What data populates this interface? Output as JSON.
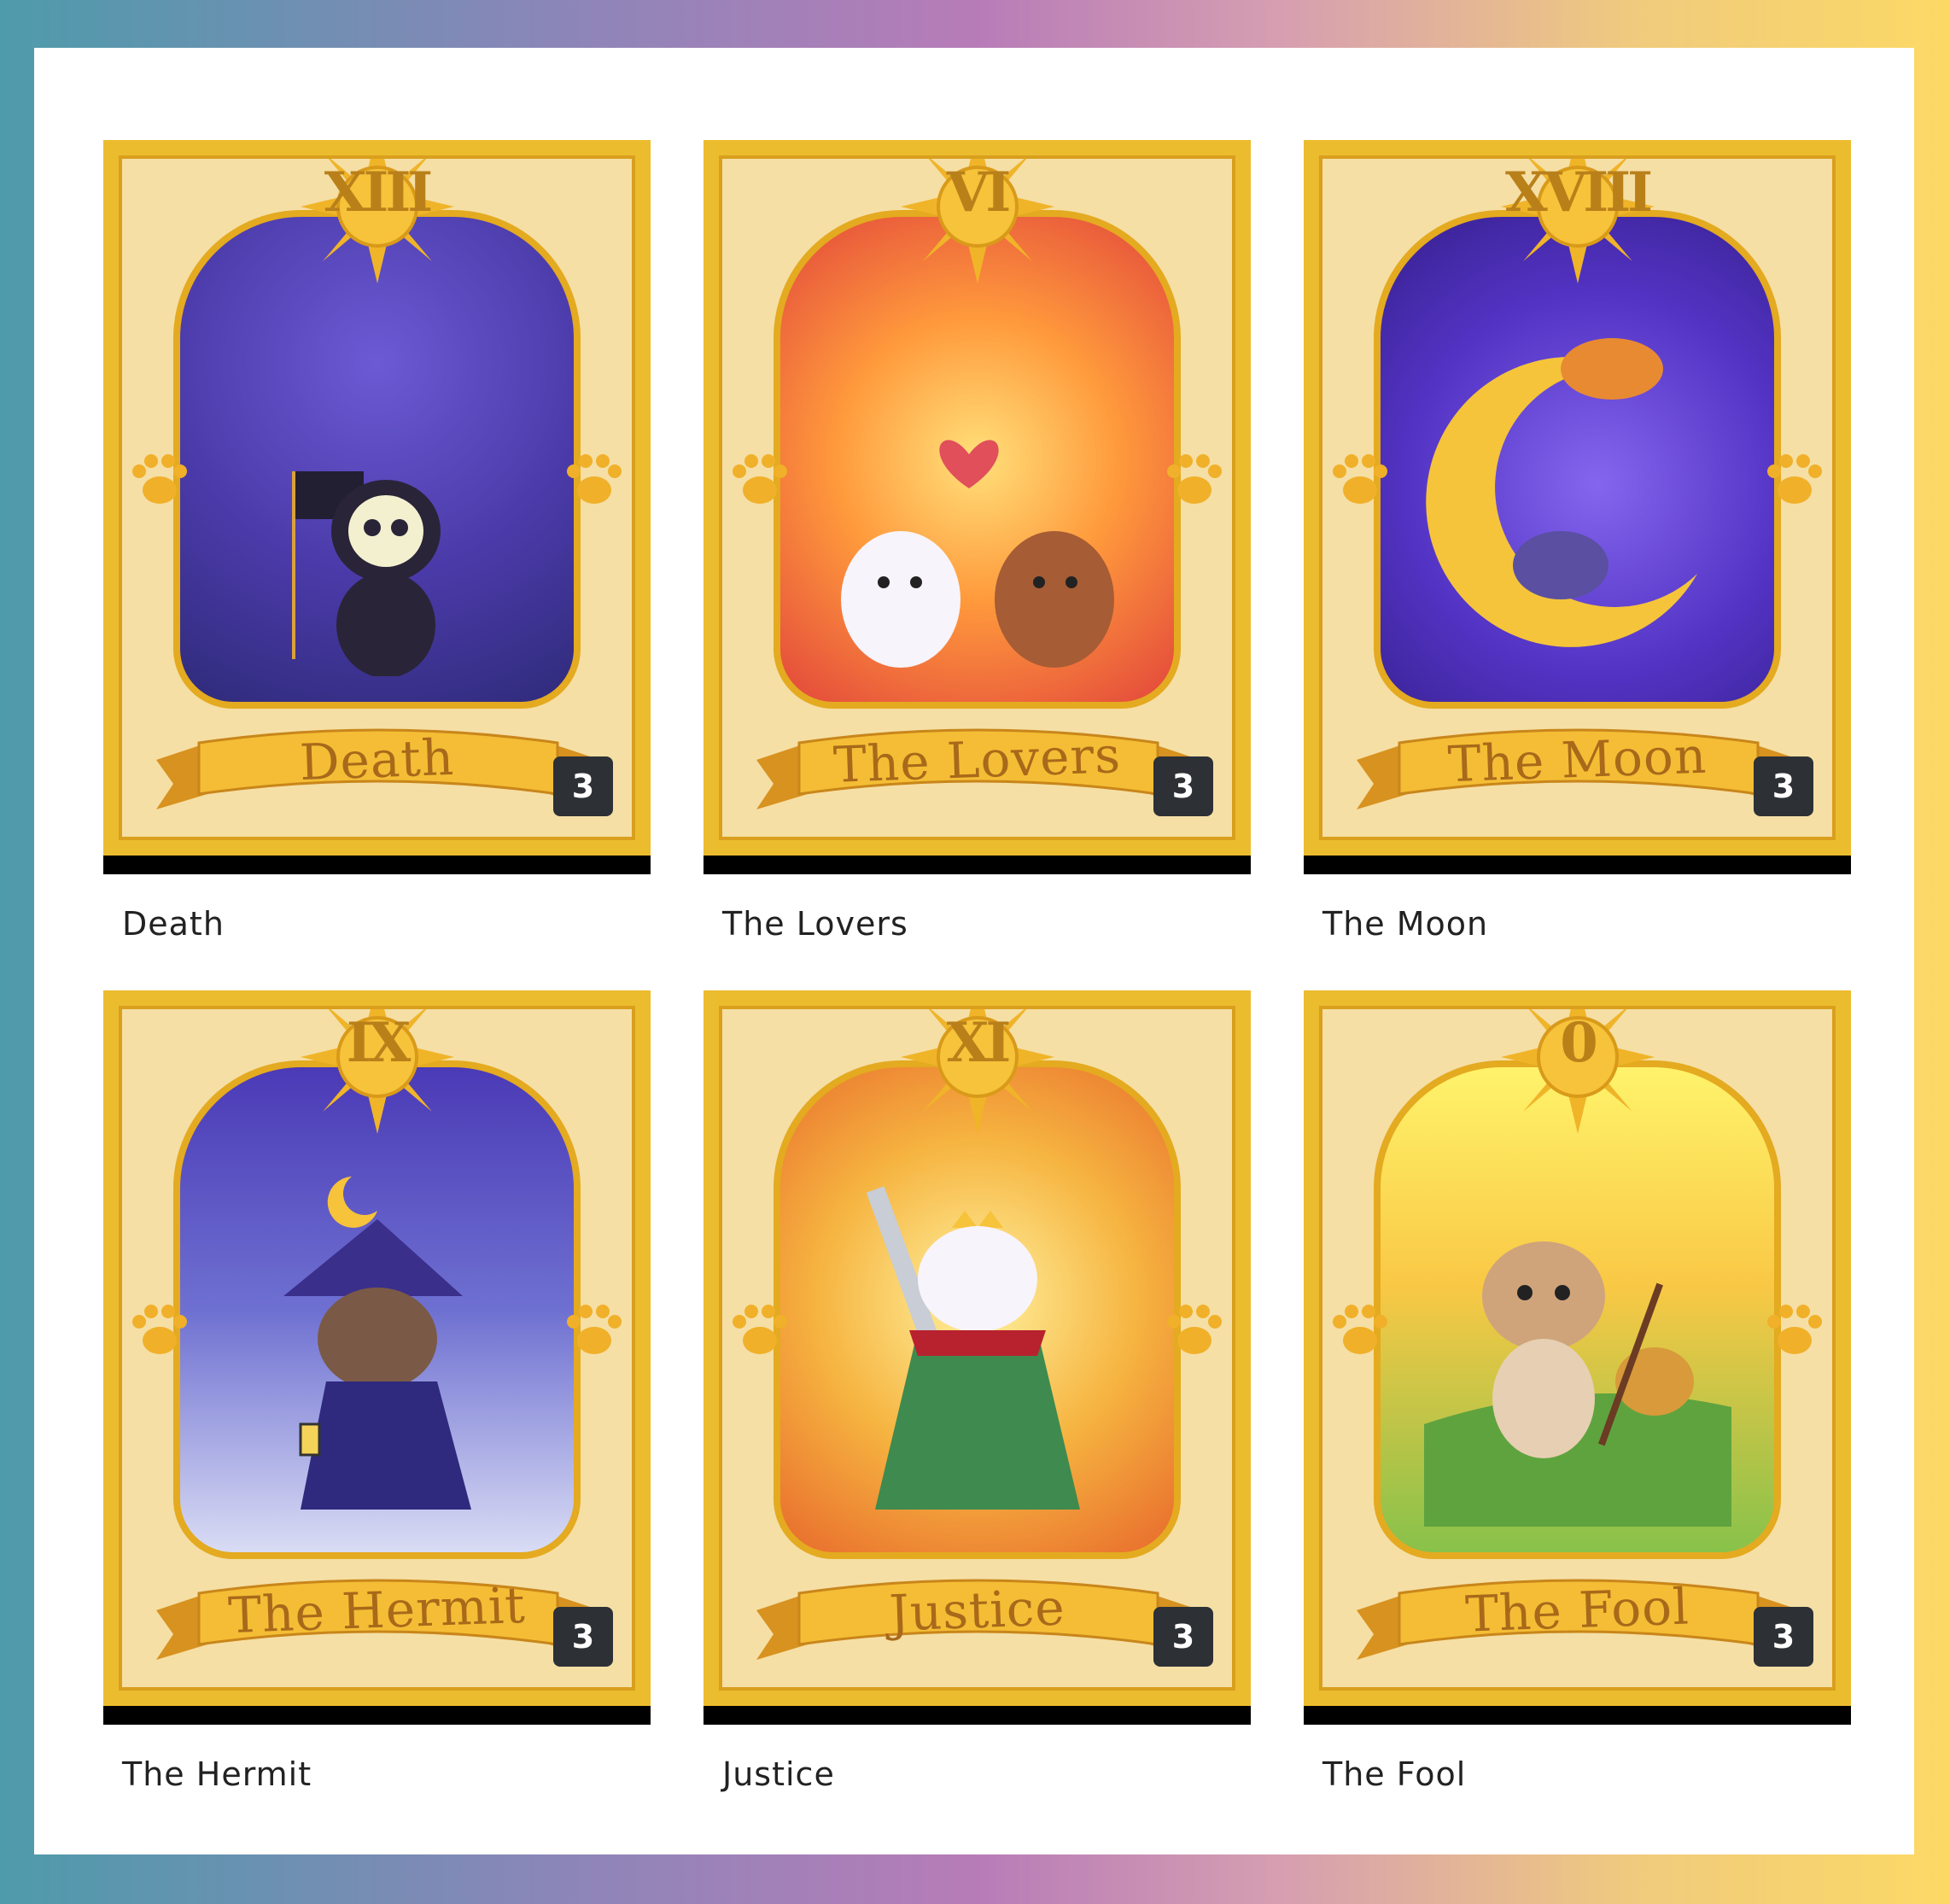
{
  "gallery": {
    "cards": [
      {
        "title": "Death",
        "numeral": "XIII",
        "banner": "Death",
        "count": "3",
        "scene": "s-death"
      },
      {
        "title": "The Lovers",
        "numeral": "VI",
        "banner": "The Lovers",
        "count": "3",
        "scene": "s-lovers"
      },
      {
        "title": "The Moon",
        "numeral": "XVIII",
        "banner": "The Moon",
        "count": "3",
        "scene": "s-moon"
      },
      {
        "title": "The Hermit",
        "numeral": "IX",
        "banner": "The Hermit",
        "count": "3",
        "scene": "s-hermit"
      },
      {
        "title": "Justice",
        "numeral": "XI",
        "banner": "Justice",
        "count": "3",
        "scene": "s-justice"
      },
      {
        "title": "The Fool",
        "numeral": "0",
        "banner": "The Fool",
        "count": "3",
        "scene": "s-fool"
      }
    ]
  }
}
